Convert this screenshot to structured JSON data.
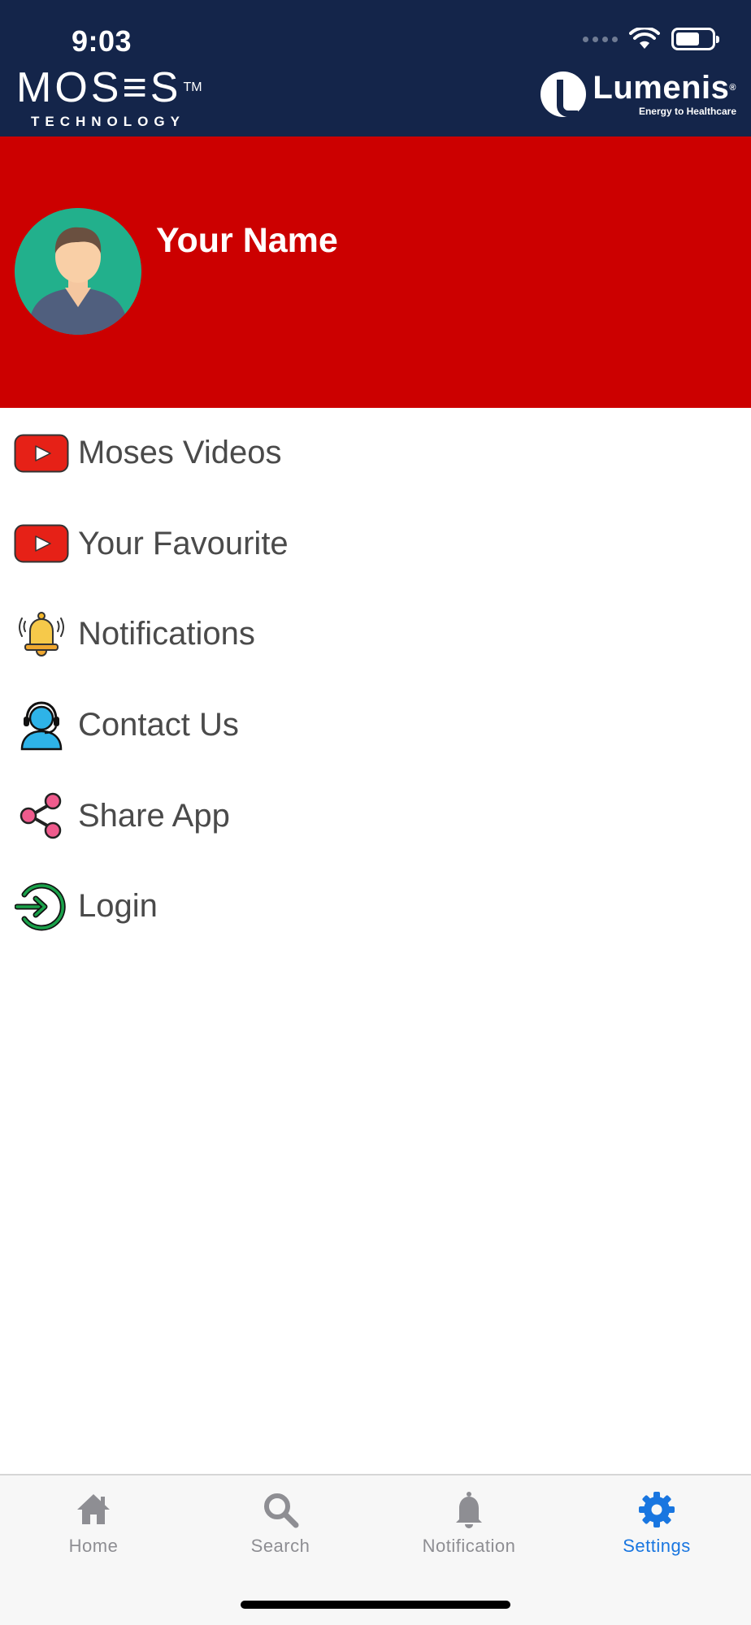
{
  "status_bar": {
    "time": "9:03"
  },
  "header": {
    "brand_left": {
      "name": "MOS≡S",
      "trademark": "TM",
      "subtitle": "TECHNOLOGY"
    },
    "brand_right": {
      "name": "Lumenis",
      "registered": "®",
      "tagline": "Energy to Healthcare"
    },
    "background_color": "#14254a"
  },
  "profile": {
    "name": "Your Name",
    "background_color": "#cc0000"
  },
  "menu": {
    "items": [
      {
        "label": "Moses Videos",
        "icon": "youtube-play-icon"
      },
      {
        "label": "Your Favourite",
        "icon": "youtube-play-icon"
      },
      {
        "label": "Notifications",
        "icon": "bell-icon"
      },
      {
        "label": "Contact Us",
        "icon": "headset-support-icon"
      },
      {
        "label": "Share App",
        "icon": "share-icon"
      },
      {
        "label": "Login",
        "icon": "login-icon"
      }
    ]
  },
  "tabbar": {
    "tabs": [
      {
        "label": "Home",
        "icon": "home-icon",
        "active": false
      },
      {
        "label": "Search",
        "icon": "search-icon",
        "active": false
      },
      {
        "label": "Notification",
        "icon": "bell-icon",
        "active": false
      },
      {
        "label": "Settings",
        "icon": "gear-icon",
        "active": true
      }
    ],
    "active_color": "#1976e0",
    "inactive_color": "#8e8e93"
  }
}
